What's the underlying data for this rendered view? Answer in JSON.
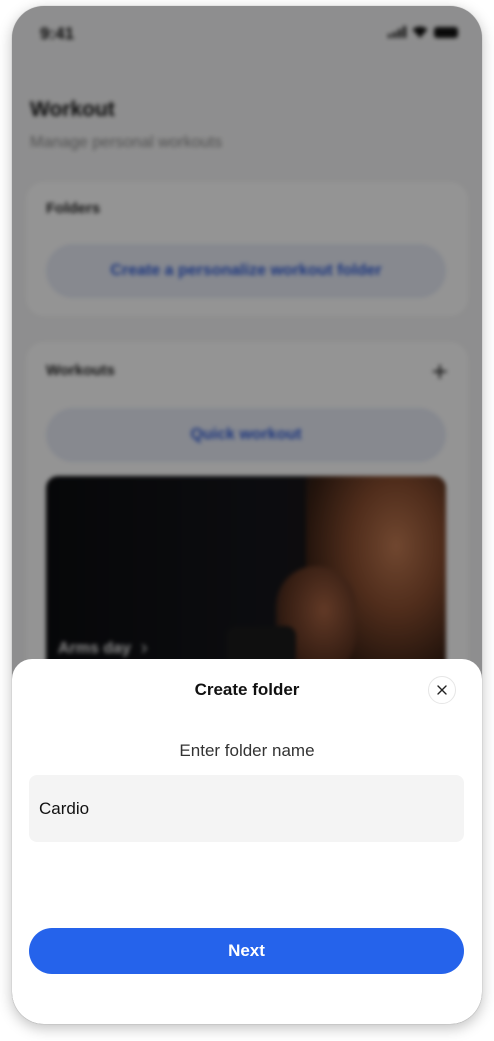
{
  "status_bar": {
    "time": "9:41"
  },
  "page": {
    "title": "Workout",
    "subtitle": "Manage personal workouts"
  },
  "folders": {
    "title": "Folders",
    "create_button": "Create a personalize workout folder"
  },
  "workouts": {
    "title": "Workouts",
    "quick_button": "Quick workout",
    "items": [
      {
        "label": "Arms day"
      }
    ]
  },
  "modal": {
    "title": "Create folder",
    "label": "Enter folder name",
    "input_value": "Cardio",
    "next_label": "Next"
  },
  "icons": {
    "add": "plus-icon",
    "close": "close-icon",
    "chevron": "chevron-right-icon",
    "signal": "signal-icon",
    "wifi": "wifi-icon",
    "battery": "battery-icon"
  },
  "colors": {
    "accent": "#2563eb",
    "pill_text": "#2e5bd8",
    "pill_bg": "#e8ecf7"
  }
}
